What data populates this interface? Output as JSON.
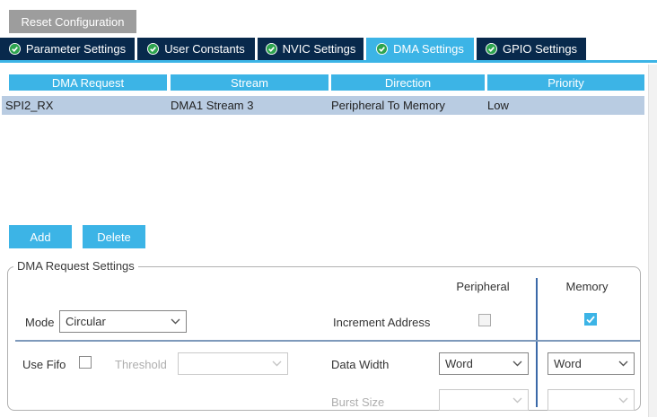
{
  "header": {
    "reset_button": "Reset Configuration"
  },
  "tabs": [
    {
      "label": "Parameter Settings",
      "state": "inactive"
    },
    {
      "label": "User Constants",
      "state": "inactive"
    },
    {
      "label": "NVIC Settings",
      "state": "inactive"
    },
    {
      "label": "DMA Settings",
      "state": "active"
    },
    {
      "label": "GPIO Settings",
      "state": "inactive"
    }
  ],
  "dma_table": {
    "columns": [
      "DMA Request",
      "Stream",
      "Direction",
      "Priority"
    ],
    "rows": [
      {
        "dma_request": "SPI2_RX",
        "stream": "DMA1 Stream 3",
        "direction": "Peripheral To Memory",
        "priority": "Low",
        "selected": true
      }
    ]
  },
  "actions": {
    "add": "Add",
    "delete": "Delete"
  },
  "settings": {
    "group_title": "DMA Request Settings",
    "column_peripheral": "Peripheral",
    "column_memory": "Memory",
    "mode": {
      "label": "Mode",
      "value": "Circular"
    },
    "increment_address": {
      "label": "Increment Address",
      "peripheral_checked": false,
      "memory_checked": true
    },
    "use_fifo": {
      "label": "Use Fifo",
      "checked": false
    },
    "threshold": {
      "label": "Threshold",
      "value": "",
      "disabled": true
    },
    "data_width": {
      "label": "Data Width",
      "peripheral_value": "Word",
      "memory_value": "Word"
    },
    "burst_size": {
      "label": "Burst Size",
      "peripheral_value": "",
      "memory_value": "",
      "disabled": true
    }
  },
  "colors": {
    "accent_blue": "#3cb4e6",
    "tab_navy": "#08294c",
    "selected_row": "#b9cce2",
    "reset_gray": "#9d9d9d",
    "check_green": "#2ea44f",
    "separator_blue": "#3b69a8"
  }
}
